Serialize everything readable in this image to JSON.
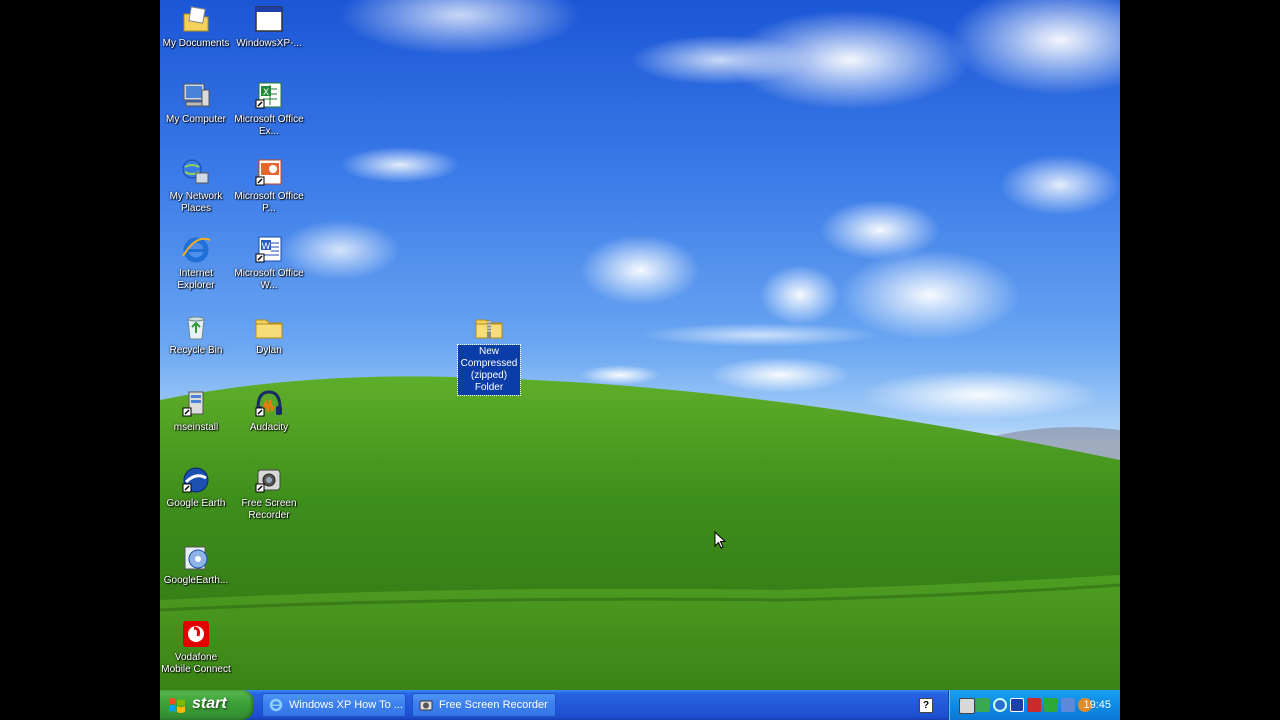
{
  "desktop": {
    "icons": [
      {
        "name": "my-documents-icon",
        "label": "My Documents",
        "selected": false
      },
      {
        "name": "windowsxp-shortcut-icon",
        "label": "WindowsXP-...",
        "selected": false
      },
      {
        "name": "my-computer-icon",
        "label": "My Computer",
        "selected": false
      },
      {
        "name": "excel-icon",
        "label": "Microsoft Office Ex...",
        "selected": false
      },
      {
        "name": "my-network-places-icon",
        "label": "My Network Places",
        "selected": false
      },
      {
        "name": "powerpoint-icon",
        "label": "Microsoft Office P...",
        "selected": false
      },
      {
        "name": "internet-explorer-icon",
        "label": "Internet Explorer",
        "selected": false
      },
      {
        "name": "word-icon",
        "label": "Microsoft Office W...",
        "selected": false
      },
      {
        "name": "recycle-bin-icon",
        "label": "Recycle Bin",
        "selected": false
      },
      {
        "name": "folder-icon",
        "label": "Dylan",
        "selected": false
      },
      {
        "name": "mseinstall-icon",
        "label": "mseinstall",
        "selected": false
      },
      {
        "name": "audacity-icon",
        "label": "Audacity",
        "selected": false
      },
      {
        "name": "google-earth-icon",
        "label": "Google Earth",
        "selected": false
      },
      {
        "name": "free-screen-recorder-icon",
        "label": "Free Screen Recorder",
        "selected": false
      },
      {
        "name": "google-earth-installer-icon",
        "label": "GoogleEarth...",
        "selected": false
      },
      {
        "name": "vodafone-icon",
        "label": "Vodafone Mobile Connect",
        "selected": false
      },
      {
        "name": "zipped-folder-icon",
        "label": "New Compressed (zipped) Folder",
        "selected": true
      }
    ]
  },
  "taskbar": {
    "start_label": "start",
    "tasks": [
      {
        "label": "Windows XP How To ...",
        "icon": "ie-icon"
      },
      {
        "label": "Free Screen Recorder",
        "icon": "camera-icon"
      }
    ],
    "clock": "19:45"
  },
  "colors": {
    "taskbar": "#2358da",
    "start": "#3ea33b",
    "tray": "#0f8be6",
    "selection": "#0b3da8"
  }
}
